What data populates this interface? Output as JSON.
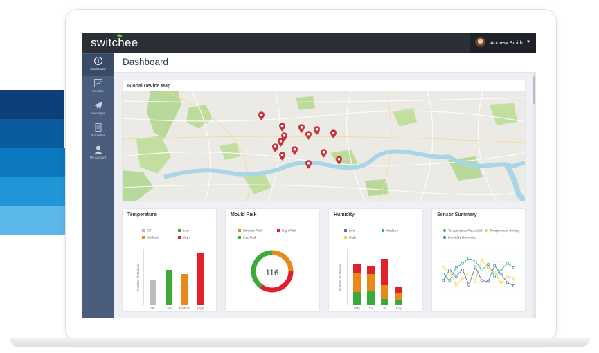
{
  "app": {
    "logo": "switchee"
  },
  "user": {
    "name": "Andrew Smith"
  },
  "sidebar": {
    "items": [
      {
        "label": "Dashboard",
        "icon": "info-icon",
        "active": true
      },
      {
        "label": "Devices",
        "icon": "chart-line-icon"
      },
      {
        "label": "Messages",
        "icon": "paper-plane-icon"
      },
      {
        "label": "Properties",
        "icon": "document-icon"
      },
      {
        "label": "My Account",
        "icon": "user-icon"
      }
    ]
  },
  "page": {
    "title": "Dashboard"
  },
  "map": {
    "title": "Global Device Map",
    "pin_count": 14,
    "pin_color": "#c8323a"
  },
  "colors": {
    "stripes": [
      "#0f3f7a",
      "#0b5c9e",
      "#0b78bf",
      "#2196d6",
      "#5cb8ea"
    ],
    "sidebar": "#4b5d7d",
    "topbar": "#2b2f36",
    "off": "#bdbdbd",
    "low": "#3aab3a",
    "medium": "#e8891c",
    "high": "#e0202a",
    "temp_recorded": "#35b08a",
    "temp_setting": "#f2d34a",
    "humidity_recorded": "#5a6fb6"
  },
  "temperature": {
    "title": "Temperature",
    "legend": [
      "Off",
      "Low",
      "Medium",
      "High"
    ],
    "ylabel": "Number of Devices",
    "chart_data": {
      "type": "bar",
      "categories": [
        "Off",
        "Low",
        "Medium",
        "High"
      ],
      "values": [
        45,
        62,
        55,
        93
      ],
      "ylim": [
        0,
        100
      ]
    }
  },
  "mould": {
    "title": "Mould Risk",
    "legend": [
      "Medium Risk",
      "High Risk",
      "Low Risk"
    ],
    "value": "116",
    "chart_data": {
      "type": "pie",
      "categories": [
        "Medium Risk",
        "High Risk",
        "Low Risk"
      ],
      "values": [
        25,
        35,
        40
      ]
    }
  },
  "humidity": {
    "title": "Humidity",
    "legend": [
      "Low",
      "Medium",
      "High"
    ],
    "ylabel": "Number of Devices",
    "chart_data": {
      "type": "bar",
      "categories": [
        "May",
        "Jun",
        "Jul",
        "Aug"
      ],
      "ylim": [
        0,
        100
      ],
      "series": [
        {
          "name": "Low",
          "values": [
            22,
            25,
            10,
            8
          ]
        },
        {
          "name": "Medium",
          "values": [
            36,
            30,
            25,
            12
          ]
        },
        {
          "name": "High",
          "values": [
            15,
            15,
            48,
            12
          ]
        }
      ]
    }
  },
  "sensor": {
    "title": "Sensor Summary",
    "legend": [
      "Temperature Recorded",
      "Temperature Setting",
      "Humidity Recorded"
    ],
    "chart_data": {
      "type": "line",
      "x": [
        1,
        2,
        3,
        4,
        5,
        6,
        7,
        8,
        9,
        10,
        11,
        12
      ],
      "ylim": [
        0,
        100
      ],
      "series": [
        {
          "name": "Temperature Recorded",
          "values": [
            45,
            30,
            60,
            70,
            82,
            75,
            55,
            68,
            40,
            55,
            70,
            60
          ]
        },
        {
          "name": "Temperature Setting",
          "values": [
            60,
            50,
            20,
            35,
            45,
            30,
            78,
            60,
            50,
            25,
            40,
            35
          ]
        },
        {
          "name": "Humidity Recorded",
          "values": [
            30,
            55,
            40,
            55,
            20,
            62,
            30,
            28,
            65,
            45,
            25,
            18
          ]
        }
      ]
    }
  }
}
